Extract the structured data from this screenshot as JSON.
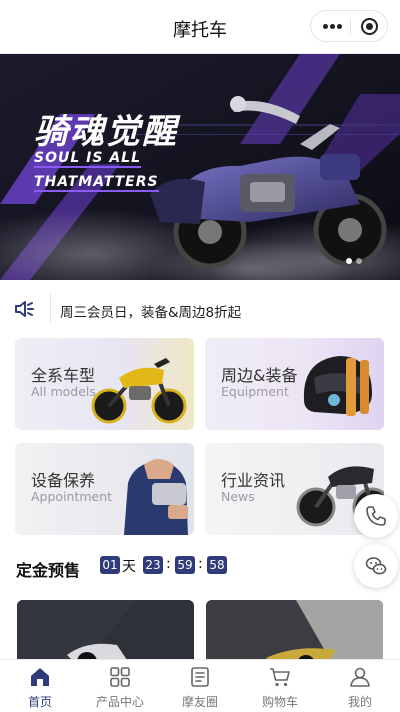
{
  "navbar": {
    "title": "摩托车"
  },
  "banner": {
    "headline": "骑魂觉醒",
    "slogan_line1": "SOUL IS ALL",
    "slogan_line2": "THATMATTERS",
    "dot_count": 2,
    "active_dot": 0
  },
  "notice": {
    "text": "周三会员日，装备&周边8折起"
  },
  "categories": [
    {
      "name": "全系车型",
      "sub": "All models"
    },
    {
      "name": "周边&装备",
      "sub": "Equipment"
    },
    {
      "name": "设备保养",
      "sub": "Appointment"
    },
    {
      "name": "行业资讯",
      "sub": "News"
    }
  ],
  "presale": {
    "label": "定金预售",
    "days": "01",
    "days_unit": "天",
    "hours": "23",
    "minutes": "59",
    "seconds": "58",
    "colon": ":"
  },
  "tabbar": [
    {
      "label": "首页",
      "icon": "home-icon"
    },
    {
      "label": "产品中心",
      "icon": "grid-icon"
    },
    {
      "label": "摩友圈",
      "icon": "document-icon"
    },
    {
      "label": "购物车",
      "icon": "cart-icon"
    },
    {
      "label": "我的",
      "icon": "user-icon"
    }
  ],
  "colors": {
    "accent": "#2f3b7a",
    "banner_purple": "#6a3fc8",
    "tab_inactive": "#777777"
  }
}
